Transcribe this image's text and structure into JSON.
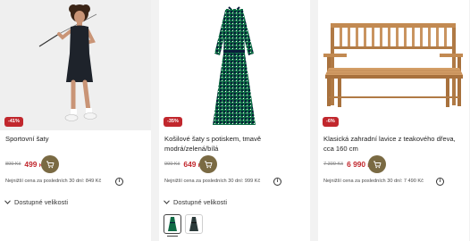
{
  "products": [
    {
      "title": "Sportovní šaty",
      "discount": "-41%",
      "old_price": "899 Kč",
      "price": "499",
      "currency": "Kč",
      "lowest_price_note": "Nejnižší cena za posledních 30 dní: 849 Kč",
      "sizes_label": "Dostupné velikosti",
      "image_icon": "woman-golfer-photo"
    },
    {
      "title": "Košilové šaty s potiskem, tmavě modrá/zelená/bílá",
      "discount": "-35%",
      "old_price": "999 Kč",
      "price": "649",
      "currency": "Kč",
      "lowest_price_note": "Nejnižší cena za posledních 30 dní: 999 Kč",
      "sizes_label": "Dostupné velikosti",
      "image_icon": "shirt-dress-photo",
      "color_swatches": [
        "green-pattern",
        "dark-pattern"
      ]
    },
    {
      "title": "Klasická zahradní lavice z teakového dřeva, cca 160 cm",
      "discount": "-6%",
      "old_price": "7 399 Kč",
      "price": "6 990",
      "currency": "Kč",
      "lowest_price_note": "Nejnižší cena za posledních 30 dní: 7 490 Kč",
      "image_icon": "teak-bench-photo"
    }
  ],
  "icons": {
    "cart": "cart-icon",
    "info": "info-icon",
    "chevron": "chevron-down-icon"
  },
  "colors": {
    "sale_red": "#c1272d",
    "cart_button": "#7a6a43",
    "page_bg": "#f2f2f2"
  }
}
